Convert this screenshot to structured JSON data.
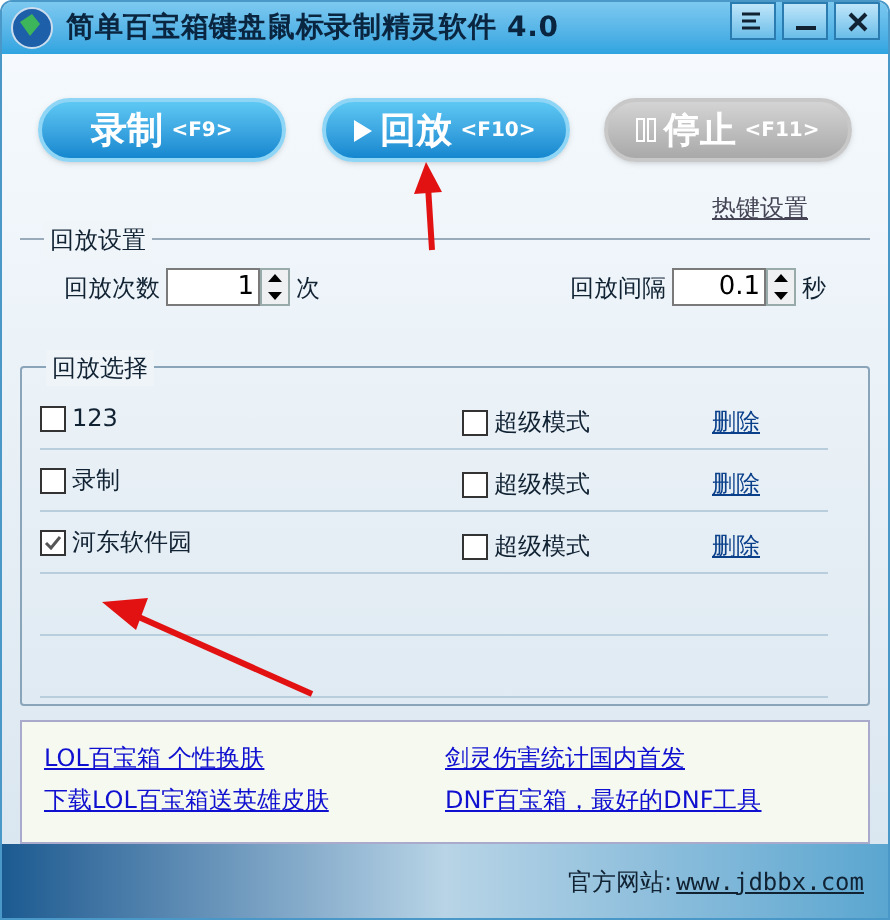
{
  "window": {
    "title": "简单百宝箱键盘鼠标录制精灵软件 4.0"
  },
  "actions": [
    {
      "label": "录制",
      "hotkey": "<F9>",
      "kind": "record",
      "disabled": false
    },
    {
      "label": "回放",
      "hotkey": "<F10>",
      "kind": "play",
      "disabled": false
    },
    {
      "label": "停止",
      "hotkey": "<F11>",
      "kind": "stop",
      "disabled": true
    }
  ],
  "hotkey_link": "热键设置",
  "playback_settings": {
    "title": "回放设置",
    "count_label": "回放次数",
    "count_value": "1",
    "count_unit": "次",
    "interval_label": "回放间隔",
    "interval_value": "0.1",
    "interval_unit": "秒"
  },
  "playback_selection": {
    "title": "回放选择",
    "items": [
      {
        "name": "123",
        "checked": false,
        "super_mode_label": "超级模式",
        "super_mode": false,
        "delete": "删除"
      },
      {
        "name": "录制",
        "checked": false,
        "super_mode_label": "超级模式",
        "super_mode": false,
        "delete": "删除"
      },
      {
        "name": "河东软件园",
        "checked": true,
        "super_mode_label": "超级模式",
        "super_mode": false,
        "delete": "删除"
      }
    ]
  },
  "links": [
    "LOL百宝箱 个性换肤",
    "剑灵伤害统计国内首发",
    "下载LOL百宝箱送英雄皮肤",
    "DNF百宝箱，最好的DNF工具"
  ],
  "footer": {
    "label": "官方网站:",
    "url": "www.jdbbx.com"
  }
}
